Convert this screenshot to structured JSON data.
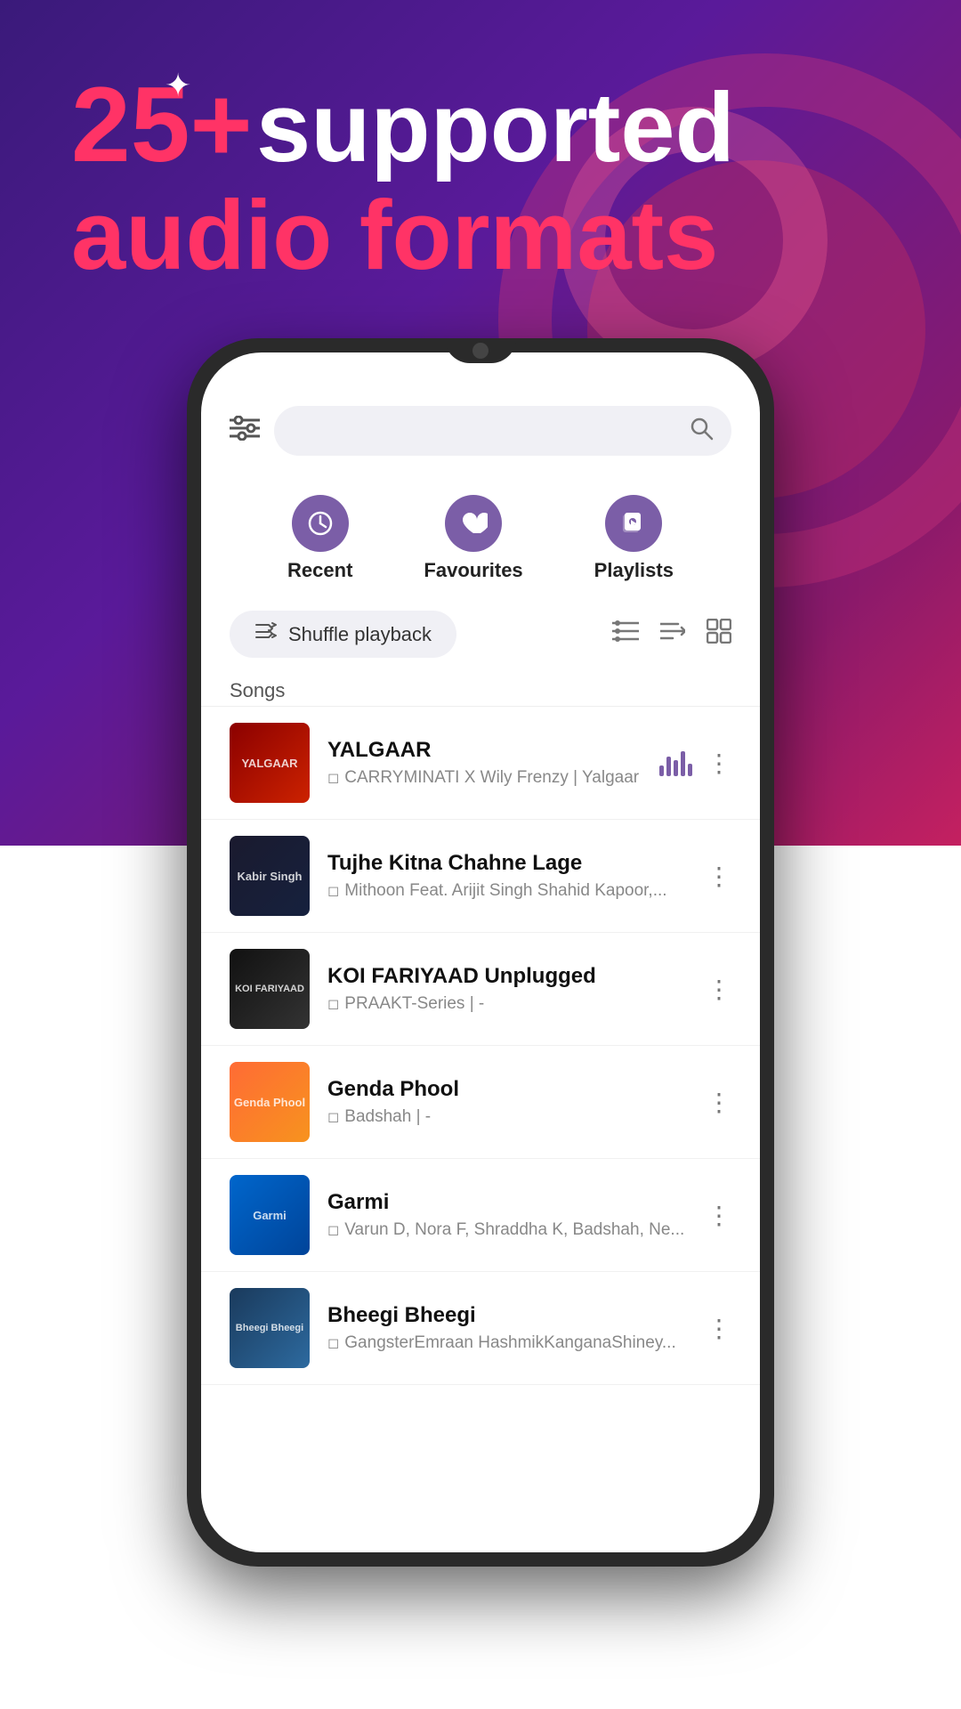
{
  "headline": {
    "number": "25+",
    "line1": " supported",
    "line2": "audio formats"
  },
  "tabs": [
    {
      "id": "recent",
      "label": "Recent",
      "icon": "🕐"
    },
    {
      "id": "favourites",
      "label": "Favourites",
      "icon": "♥"
    },
    {
      "id": "playlists",
      "label": "Playlists",
      "icon": "🎵"
    }
  ],
  "controls": {
    "shuffle_label": "Shuffle playback",
    "songs_header": "Songs"
  },
  "songs": [
    {
      "id": 1,
      "title": "YALGAAR",
      "meta": "CARRYMINATI X Wily Frenzy | Yalgaar",
      "thumb_class": "thumb-yalgaar",
      "thumb_text": "YALGAAR",
      "has_waveform": true
    },
    {
      "id": 2,
      "title": "Tujhe Kitna Chahne Lage",
      "meta": "Mithoon Feat. Arijit Singh Shahid Kapoor,...",
      "thumb_class": "thumb-kabir",
      "thumb_text": "Kabir Singh",
      "has_waveform": false
    },
    {
      "id": 3,
      "title": "KOI FARIYAAD Unplugged",
      "meta": "PRAAKT-Series | -",
      "thumb_class": "thumb-koi",
      "thumb_text": "KOI FARIYAAD",
      "has_waveform": false
    },
    {
      "id": 4,
      "title": "Genda Phool",
      "meta": "Badshah | -",
      "thumb_class": "thumb-genda",
      "thumb_text": "Genda Phool",
      "has_waveform": false
    },
    {
      "id": 5,
      "title": "Garmi",
      "meta": "Varun D, Nora F, Shraddha K, Badshah, Ne...",
      "thumb_class": "thumb-garmi",
      "thumb_text": "Garmi",
      "has_waveform": false
    },
    {
      "id": 6,
      "title": "Bheegi Bheegi",
      "meta": "GangsterEmraan HashmikKanganaShiney...",
      "thumb_class": "thumb-bheegi",
      "thumb_text": "Bheegi Bheegi",
      "has_waveform": false
    }
  ]
}
